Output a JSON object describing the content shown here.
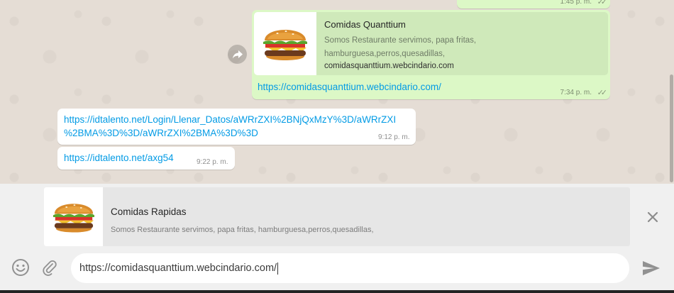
{
  "chat": {
    "top_message": {
      "time": "1:45 p. m."
    },
    "outgoing_link_message": {
      "preview_title": "Comidas Quanttium",
      "preview_description": "Somos Restaurante servimos, papa fritas, hamburguesa,perros,quesadillas,",
      "preview_domain": "comidasquanttium.webcindario.com",
      "link_text": "https://comidasquanttium.webcindario.com/",
      "time": "7:34 p. m."
    },
    "incoming_messages": [
      {
        "line1": "https://idtalento.net/Login/Llenar_Datos/aWRrZXI%2BNjQxMzY%3D/aWRrZXI",
        "line2": "%2BMA%3D%3D/aWRrZXI%2BMA%3D%3D",
        "time": "9:12 p. m."
      },
      {
        "line1": "https://idtalento.net/axg54",
        "time": "9:22 p. m."
      }
    ]
  },
  "compose": {
    "link_preview": {
      "title": "Comidas Rapidas",
      "description": "Somos Restaurante servimos, papa fritas, hamburguesa,perros,quesadillas,"
    },
    "input_value": "https://comidasquanttium.webcindario.com/"
  },
  "icons": {
    "forward": "forward-icon",
    "close": "close-icon",
    "emoji": "emoji-icon",
    "attach": "attach-icon",
    "send": "send-icon",
    "ticks": "double-check-icon"
  },
  "colors": {
    "outgoing_bubble": "#dcf8c6",
    "incoming_bubble": "#ffffff",
    "link": "#039be5",
    "chat_background": "#e5ddd5",
    "compose_background": "#f0f0f0"
  }
}
